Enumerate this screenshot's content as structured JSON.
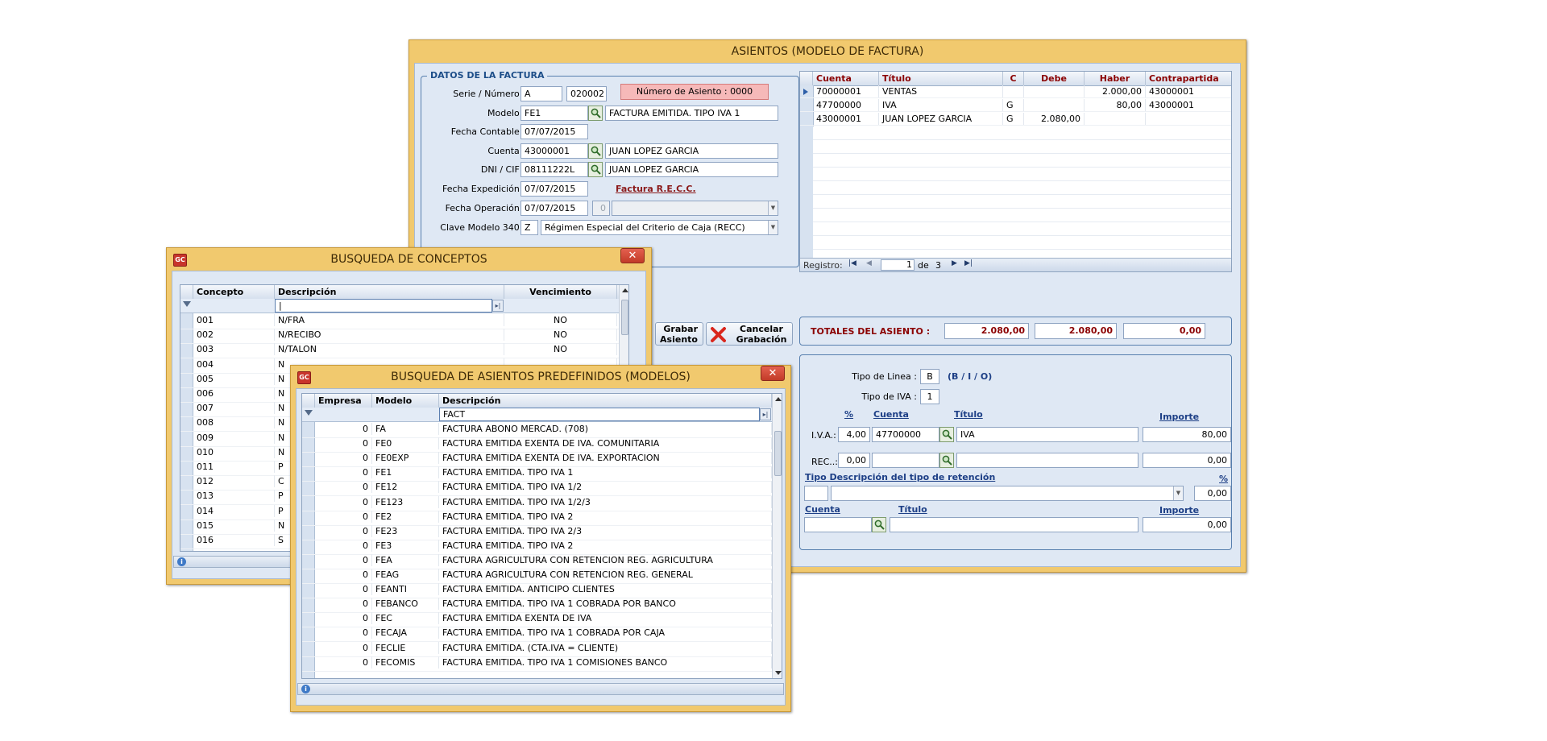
{
  "asientos_window": {
    "title": "ASIENTOS (MODELO DE FACTURA)",
    "datos_title": "DATOS DE LA FACTURA",
    "serie_label": "Serie / Número :",
    "serie_value": "A",
    "numero_value": "020002",
    "numero_asiento": "Número de Asiento : 0000",
    "modelo_label": "Modelo :",
    "modelo_code": "FE1",
    "modelo_desc": "FACTURA EMITIDA. TIPO IVA 1",
    "fecha_contable_label": "Fecha Contable :",
    "fecha_contable": "07/07/2015",
    "cuenta_label": "Cuenta :",
    "cuenta_code": "43000001",
    "cuenta_name": "JUAN LOPEZ GARCIA",
    "dni_label": "DNI / CIF :",
    "dni_value": "08111222L",
    "dni_name": "JUAN LOPEZ GARCIA",
    "fecha_expedicion_label": "Fecha Expedición :",
    "fecha_expedicion": "07/07/2015",
    "factura_recc_link": "Factura R.E.C.C.",
    "fecha_operacion_label": "Fecha Operación :",
    "fecha_operacion": "07/07/2015",
    "fecha_operacion_num": "0",
    "clave_label": "Clave Modelo 340 :",
    "clave_code": "Z",
    "clave_desc": "Régimen Especial del Criterio de Caja (RECC)",
    "grid_headers": [
      "Cuenta",
      "Título",
      "C",
      "Debe",
      "Haber",
      "Contrapartida"
    ],
    "grid_rows": [
      [
        "70000001",
        "VENTAS",
        "",
        "",
        "2.000,00",
        "43000001"
      ],
      [
        "47700000",
        "IVA",
        "G",
        "",
        "80,00",
        "43000001"
      ],
      [
        "43000001",
        "JUAN LOPEZ GARCIA",
        "G",
        "2.080,00",
        "",
        ""
      ]
    ],
    "registro_label": "Registro:",
    "registro_current": "1",
    "registro_de": "de",
    "registro_total": "3",
    "grabar_label1": "Grabar",
    "grabar_label2": "Asiento",
    "cancelar_label1": "Cancelar",
    "cancelar_label2": "Grabación",
    "totales_label": "TOTALES DEL ASIENTO :",
    "total_debe": "2.080,00",
    "total_haber": "2.080,00",
    "total_diff": "0,00",
    "tipo_linea_label": "Tipo de Linea :",
    "tipo_linea_value": "B",
    "tipo_linea_hint": "(B / I / O)",
    "tipo_iva_label": "Tipo de IVA :",
    "tipo_iva_value": "1",
    "pct_header": "%",
    "cuenta_header": "Cuenta",
    "titulo_header": "Título",
    "importe_header": "Importe",
    "iva_label": "I.V.A.:",
    "iva_pct": "4,00",
    "iva_cuenta": "47700000",
    "iva_titulo": "IVA",
    "iva_importe": "80,00",
    "rec_label": "REC..:",
    "rec_pct": "0,00",
    "rec_importe": "0,00",
    "retencion_header": "Tipo Descripción del tipo de retención",
    "retencion_pct_header": "%",
    "retencion_pct": "0,00",
    "cuenta2_header": "Cuenta",
    "titulo2_header": "Título",
    "importe2_header": "Importe",
    "importe2_value": "0,00"
  },
  "conceptos_window": {
    "title": "BUSQUEDA DE CONCEPTOS",
    "gc": "GC",
    "headers": [
      "Concepto",
      "Descripción",
      "Vencimiento"
    ],
    "rows": [
      [
        "001",
        "N/FRA",
        "NO"
      ],
      [
        "002",
        "N/RECIBO",
        "NO"
      ],
      [
        "003",
        "N/TALON",
        "NO"
      ],
      [
        "004",
        "N",
        ""
      ],
      [
        "005",
        "N",
        ""
      ],
      [
        "006",
        "N",
        ""
      ],
      [
        "007",
        "N",
        ""
      ],
      [
        "008",
        "N",
        ""
      ],
      [
        "009",
        "N",
        ""
      ],
      [
        "010",
        "N",
        ""
      ],
      [
        "011",
        "P",
        ""
      ],
      [
        "012",
        "C",
        ""
      ],
      [
        "013",
        "P",
        ""
      ],
      [
        "014",
        "P",
        ""
      ],
      [
        "015",
        "N",
        ""
      ],
      [
        "016",
        "S",
        ""
      ]
    ]
  },
  "modelos_window": {
    "title": "BUSQUEDA DE ASIENTOS PREDEFINIDOS (MODELOS)",
    "gc": "GC",
    "headers": [
      "Empresa",
      "Modelo",
      "Descripción"
    ],
    "filter_value": "FACT",
    "rows": [
      [
        "0",
        "FA",
        "FACTURA ABONO MERCAD. (708)"
      ],
      [
        "0",
        "FE0",
        "FACTURA EMITIDA EXENTA DE IVA. COMUNITARIA"
      ],
      [
        "0",
        "FE0EXP",
        "FACTURA EMITIDA EXENTA DE IVA. EXPORTACION"
      ],
      [
        "0",
        "FE1",
        "FACTURA EMITIDA. TIPO IVA 1"
      ],
      [
        "0",
        "FE12",
        "FACTURA EMITIDA. TIPO IVA 1/2"
      ],
      [
        "0",
        "FE123",
        "FACTURA EMITIDA. TIPO IVA 1/2/3"
      ],
      [
        "0",
        "FE2",
        "FACTURA EMITIDA. TIPO IVA 2"
      ],
      [
        "0",
        "FE23",
        "FACTURA EMITIDA. TIPO IVA 2/3"
      ],
      [
        "0",
        "FE3",
        "FACTURA EMITIDA. TIPO IVA 2"
      ],
      [
        "0",
        "FEA",
        "FACTURA AGRICULTURA CON RETENCION REG. AGRICULTURA"
      ],
      [
        "0",
        "FEAG",
        "FACTURA AGRICULTURA CON RETENCION REG. GENERAL"
      ],
      [
        "0",
        "FEANTI",
        "FACTURA EMITIDA. ANTICIPO CLIENTES"
      ],
      [
        "0",
        "FEBANCO",
        "FACTURA EMITIDA. TIPO IVA 1 COBRADA POR BANCO"
      ],
      [
        "0",
        "FEC",
        "FACTURA EMITIDA EXENTA DE IVA"
      ],
      [
        "0",
        "FECAJA",
        "FACTURA EMITIDA. TIPO IVA 1 COBRADA POR CAJA"
      ],
      [
        "0",
        "FECLIE",
        "FACTURA EMITIDA. (CTA.IVA = CLIENTE)"
      ],
      [
        "0",
        "FECOMIS",
        "FACTURA EMITIDA. TIPO IVA 1 COMISIONES  BANCO"
      ]
    ]
  }
}
